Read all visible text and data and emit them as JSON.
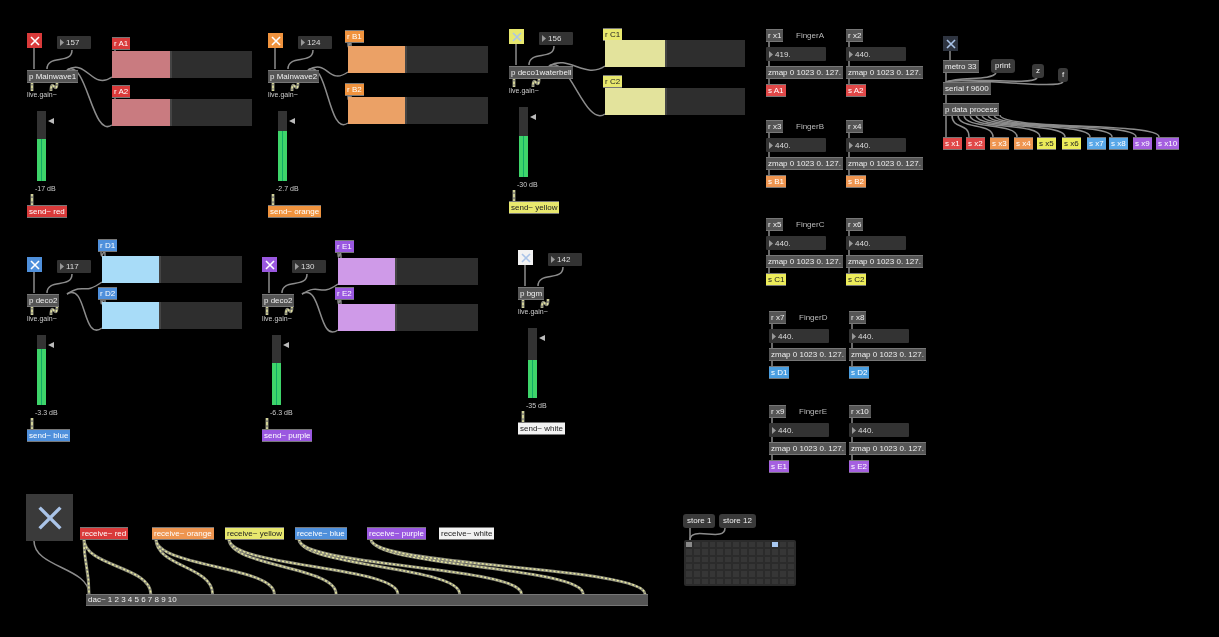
{
  "channels": [
    {
      "color": "#d93a3a",
      "toggle_on": true,
      "number": "157",
      "patcher": "p Mainwave1",
      "gain_label": "live.gain~",
      "meter": {
        "level": 0.6
      },
      "reading": "-17 dB",
      "send": "send~ red",
      "sliders": [
        {
          "receive": "r A1",
          "level": 0.43,
          "color": "#c97b80"
        },
        {
          "receive": "r A2",
          "level": 0.43,
          "color": "#c97b80"
        }
      ]
    },
    {
      "color": "#f0933e",
      "toggle_on": true,
      "number": "124",
      "patcher": "p Mainwave2",
      "gain_label": "live.gain~",
      "meter": {
        "level": 0.72
      },
      "reading": "-2.7 dB",
      "send": "send~ orange",
      "sliders": [
        {
          "receive": "r B1",
          "level": 0.42,
          "color": "#eba166"
        },
        {
          "receive": "r B2",
          "level": 0.42,
          "color": "#eba166"
        }
      ]
    },
    {
      "color": "#e8e86e",
      "toggle_on": true,
      "number": "156",
      "patcher": "p deco1waterbell",
      "gain_label": "live.gain~",
      "meter": {
        "level": 0.58
      },
      "reading": "-30 dB",
      "send": "send~ yellow",
      "sliders": [
        {
          "receive": "r C1",
          "level": 0.44,
          "color": "#e3e39c"
        },
        {
          "receive": "r C2",
          "level": 0.44,
          "color": "#e3e39c"
        }
      ]
    },
    {
      "color": "#4f90dc",
      "toggle_on": true,
      "number": "117",
      "patcher": "p deco2",
      "gain_label": "live.gain~",
      "meter": {
        "level": 0.8
      },
      "reading": "-3.3 dB",
      "send": "send~ blue",
      "sliders": [
        {
          "receive": "r D1",
          "level": 0.42,
          "color": "#a8dcf8"
        },
        {
          "receive": "r D2",
          "level": 0.42,
          "color": "#a8dcf8"
        }
      ]
    },
    {
      "color": "#9a58e0",
      "toggle_on": true,
      "number": "130",
      "patcher": "p deco2",
      "gain_label": "live.gain~",
      "meter": {
        "level": 0.6
      },
      "reading": "-6.3 dB",
      "send": "send~ purple",
      "sliders": [
        {
          "receive": "r E1",
          "level": 0.42,
          "color": "#cf9ae8"
        },
        {
          "receive": "r E2",
          "level": 0.42,
          "color": "#cf9ae8"
        }
      ]
    },
    {
      "color": "#f2f2f2",
      "toggle_on": true,
      "number": "142",
      "patcher": "p bgm",
      "gain_label": "live.gain~",
      "meter": {
        "level": 0.55
      },
      "reading": "-35 dB",
      "send": "send~ white"
    }
  ],
  "fingers": [
    {
      "title": "FingerA",
      "columns": [
        {
          "receive": "r x1",
          "number": "419.",
          "zmap": "zmap 0 1023 0. 127.",
          "send": "s A1",
          "color": "#e04848"
        },
        {
          "receive": "r x2",
          "number": "440.",
          "zmap": "zmap 0 1023 0. 127.",
          "send": "s A2",
          "color": "#e04848"
        }
      ]
    },
    {
      "title": "FingerB",
      "columns": [
        {
          "receive": "r x3",
          "number": "440.",
          "zmap": "zmap 0 1023 0. 127.",
          "send": "s B1",
          "color": "#ee9550"
        },
        {
          "receive": "r x4",
          "number": "440.",
          "zmap": "zmap 0 1023 0. 127.",
          "send": "s B2",
          "color": "#ee9550"
        }
      ]
    },
    {
      "title": "FingerC",
      "columns": [
        {
          "receive": "r x5",
          "number": "440.",
          "zmap": "zmap 0 1023 0. 127.",
          "send": "s C1",
          "color": "#ecec5a"
        },
        {
          "receive": "r x6",
          "number": "440.",
          "zmap": "zmap 0 1023 0. 127.",
          "send": "s C2",
          "color": "#ecec5a"
        }
      ]
    },
    {
      "title": "FingerD",
      "columns": [
        {
          "receive": "r x7",
          "number": "440.",
          "zmap": "zmap 0 1023 0. 127.",
          "send": "s D1",
          "color": "#4a9ee0"
        },
        {
          "receive": "r x8",
          "number": "440.",
          "zmap": "zmap 0 1023 0. 127.",
          "send": "s D2",
          "color": "#4a9ee0"
        }
      ]
    },
    {
      "title": "FingerE",
      "columns": [
        {
          "receive": "r x9",
          "number": "440.",
          "zmap": "zmap 0 1023 0. 127.",
          "send": "s E1",
          "color": "#a560e0"
        },
        {
          "receive": "r x10",
          "number": "440.",
          "zmap": "zmap 0 1023 0. 127.",
          "send": "s E2",
          "color": "#a560e0"
        }
      ]
    }
  ],
  "serial": {
    "toggle_on": true,
    "metro": "metro 33",
    "messages": [
      "print",
      "z",
      "f"
    ],
    "serial": "serial f 9600",
    "process": "p data process",
    "sends": [
      {
        "label": "s x1",
        "color": "#e04848"
      },
      {
        "label": "s x2",
        "color": "#e04848"
      },
      {
        "label": "s x3",
        "color": "#ee9550"
      },
      {
        "label": "s x4",
        "color": "#ee9550"
      },
      {
        "label": "s x5",
        "color": "#ecec5a"
      },
      {
        "label": "s x6",
        "color": "#ecec5a"
      },
      {
        "label": "s x7",
        "color": "#5aa8e8"
      },
      {
        "label": "s x8",
        "color": "#5aa8e8"
      },
      {
        "label": "s x9",
        "color": "#a560e0"
      },
      {
        "label": "s x10",
        "color": "#a560e0"
      }
    ]
  },
  "output": {
    "toggle_on": true,
    "receives": [
      {
        "label": "receive~ red",
        "color": "#d93a3a"
      },
      {
        "label": "receive~ orange",
        "color": "#ee9550"
      },
      {
        "label": "receive~ yellow",
        "color": "#e8e86e"
      },
      {
        "label": "receive~ blue",
        "color": "#4f90dc"
      },
      {
        "label": "receive~ purple",
        "color": "#9a58e0"
      },
      {
        "label": "receive~ white",
        "color": "#f2f2f2"
      }
    ],
    "dac": "dac~ 1 2 3 4 5 6 7 8 9 10"
  },
  "preset": {
    "messages": [
      "store 1",
      "store 12"
    ],
    "slots": [
      {
        "stored": true,
        "selected": false
      },
      {
        "stored": false,
        "selected": false
      },
      {
        "stored": false,
        "selected": false
      },
      {
        "stored": false,
        "selected": false
      },
      {
        "stored": false,
        "selected": false
      },
      {
        "stored": false,
        "selected": false
      },
      {
        "stored": false,
        "selected": false
      },
      {
        "stored": false,
        "selected": false
      },
      {
        "stored": false,
        "selected": false
      },
      {
        "stored": false,
        "selected": false
      },
      {
        "stored": false,
        "selected": false
      },
      {
        "stored": true,
        "selected": true
      }
    ]
  }
}
